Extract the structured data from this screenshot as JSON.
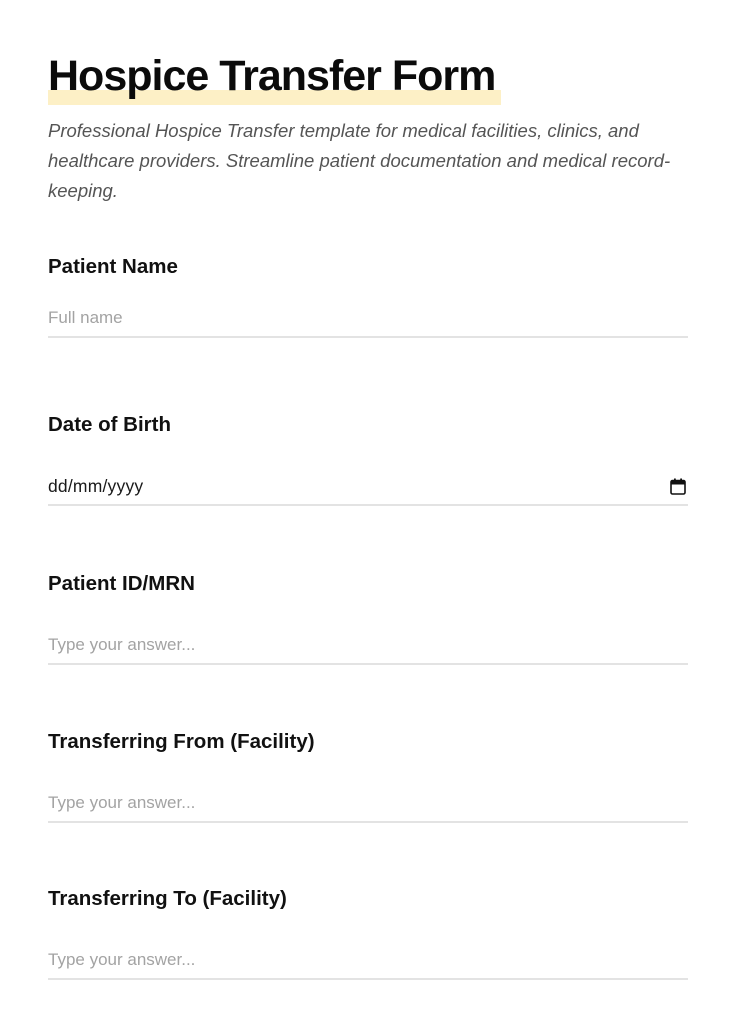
{
  "form": {
    "title": "Hospice Transfer Form",
    "description": "Professional Hospice Transfer template for medical facilities, clinics, and healthcare providers. Streamline patient documentation and medical record-keeping.",
    "accent_highlight_color": "#fdf0c6",
    "fields": {
      "patient_name": {
        "label": "Patient Name",
        "placeholder": "Full name",
        "value": ""
      },
      "date_of_birth": {
        "label": "Date of Birth",
        "placeholder": "dd/mm/yyyy",
        "icon": "calendar-icon"
      },
      "patient_id": {
        "label": "Patient ID/MRN",
        "placeholder": "Type your answer...",
        "value": ""
      },
      "transferring_from": {
        "label": "Transferring From (Facility)",
        "placeholder": "Type your answer...",
        "value": ""
      },
      "transferring_to": {
        "label": "Transferring To (Facility)",
        "placeholder": "Type your answer...",
        "value": ""
      }
    }
  }
}
